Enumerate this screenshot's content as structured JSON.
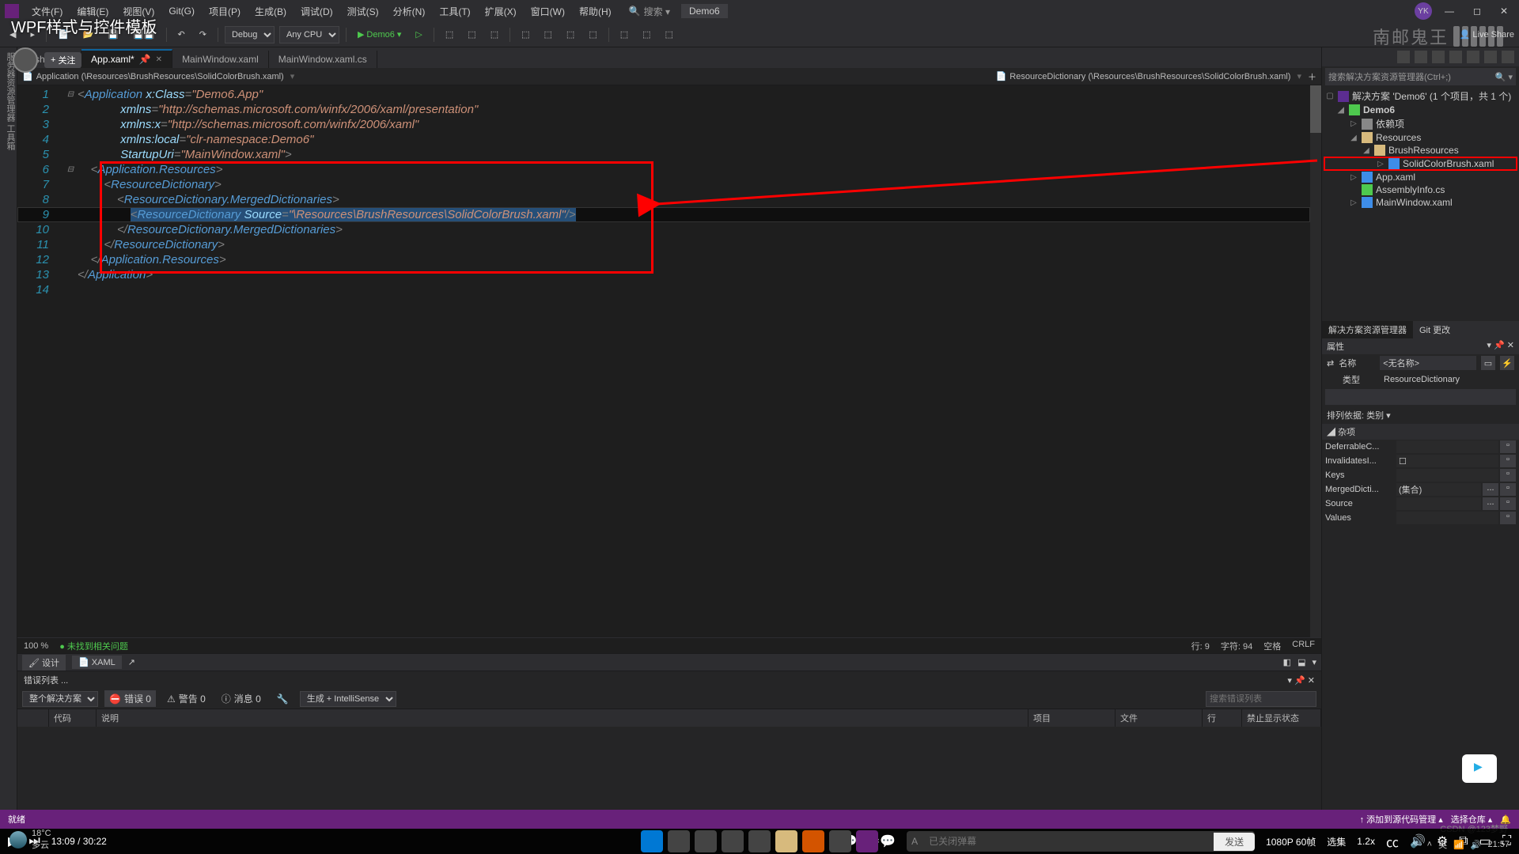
{
  "overlay_title": "WPF样式与控件模板",
  "menu": [
    "文件(F)",
    "编辑(E)",
    "视图(V)",
    "Git(G)",
    "项目(P)",
    "生成(B)",
    "调试(D)",
    "测试(S)",
    "分析(N)",
    "工具(T)",
    "扩展(X)",
    "窗口(W)",
    "帮助(H)"
  ],
  "top_search_placeholder": "搜索 ▾",
  "solution_name_top": "Demo6",
  "avatar_initials": "YK",
  "toolbar2": {
    "config": "Debug",
    "platform": "Any CPU",
    "start_label": "Demo6",
    "live_share": "Live Share"
  },
  "brand_cn": "南邮鬼王",
  "follow_label": "关注",
  "tabs": [
    {
      "label": "...sh.xaml*",
      "active": false
    },
    {
      "label": "App.xaml*",
      "active": true
    },
    {
      "label": "MainWindow.xaml",
      "active": false
    },
    {
      "label": "MainWindow.xaml.cs",
      "active": false
    }
  ],
  "breadcrumb": {
    "left": "Application (\\Resources\\BrushResources\\SolidColorBrush.xaml)",
    "right": "ResourceDictionary (\\Resources\\BrushResources\\SolidColorBrush.xaml)"
  },
  "code": {
    "l1": {
      "pre": "<",
      "tag": "Application",
      "sp": " ",
      "attr": "x:Class",
      "eq": "=",
      "val": "\"Demo6.App\""
    },
    "l2": {
      "attr": "xmlns",
      "eq": "=",
      "val": "\"http://schemas.microsoft.com/winfx/2006/xaml/presentation\""
    },
    "l3": {
      "attr": "xmlns:x",
      "eq": "=",
      "val": "\"http://schemas.microsoft.com/winfx/2006/xaml\""
    },
    "l4": {
      "attr": "xmlns:local",
      "eq": "=",
      "val": "\"clr-namespace:Demo6\""
    },
    "l5": {
      "attr": "StartupUri",
      "eq": "=",
      "val": "\"MainWindow.xaml\"",
      "close": ">"
    },
    "l6": {
      "pre": "<",
      "tag": "Application.Resources",
      "close": ">"
    },
    "l7": {
      "pre": "<",
      "tag": "ResourceDictionary",
      "close": ">"
    },
    "l8": {
      "pre": "<",
      "tag": "ResourceDictionary.MergedDictionaries",
      "close": ">"
    },
    "l9": {
      "pre": "<",
      "tag": "ResourceDictionary",
      "sp": " ",
      "attr": "Source",
      "eq": "=",
      "val": "\"\\Resources\\BrushResources\\SolidColorBrush.xaml\"",
      "close": "/>"
    },
    "l10": {
      "pre": "</",
      "tag": "ResourceDictionary.MergedDictionaries",
      "close": ">"
    },
    "l11": {
      "pre": "</",
      "tag": "ResourceDictionary",
      "close": ">"
    },
    "l12": {
      "pre": "</",
      "tag": "Application.Resources",
      "close": ">"
    },
    "l13": {
      "pre": "</",
      "tag": "Application",
      "close": ">"
    }
  },
  "status_strip": {
    "zoom": "100 %",
    "issues": "未找到相关问题",
    "line": "行: 9",
    "col": "字符: 94",
    "spaces": "空格",
    "crlf": "CRLF"
  },
  "design_xaml": {
    "design": "设计",
    "xaml": "XAML"
  },
  "error_panel": {
    "title": "错误列表 ...",
    "scope": "整个解决方案",
    "err": "错误 0",
    "warn": "警告 0",
    "info": "消息 0",
    "build": "生成 + IntelliSense",
    "search_placeholder": "搜索错误列表",
    "cols": [
      "",
      "代码",
      "说明",
      "项目",
      "文件",
      "行",
      "禁止显示状态"
    ]
  },
  "solution_explorer": {
    "search_placeholder": "搜索解决方案资源管理器(Ctrl+;)",
    "root": "解决方案 'Demo6' (1 个项目，共 1 个)",
    "project": "Demo6",
    "deps": "依赖项",
    "resources": "Resources",
    "brush": "BrushResources",
    "solidcolor": "SolidColorBrush.xaml",
    "appxaml": "App.xaml",
    "assemblyinfo": "AssemblyInfo.cs",
    "mainwindow": "MainWindow.xaml",
    "tab_se": "解决方案资源管理器",
    "tab_git": "Git 更改"
  },
  "properties": {
    "title": "属性",
    "name_lbl": "名称",
    "name_val": "<无名称>",
    "type_lbl": "类型",
    "type_val": "ResourceDictionary",
    "sort": "排列依据: 类别 ▾",
    "cat": "杂项",
    "rows": [
      {
        "n": "DeferrableC...",
        "v": ""
      },
      {
        "n": "InvalidatesI...",
        "v": "☐"
      },
      {
        "n": "Keys",
        "v": ""
      },
      {
        "n": "MergedDicti...",
        "v": "(集合)",
        "btn": "..."
      },
      {
        "n": "Source",
        "v": "",
        "btn": "..."
      },
      {
        "n": "Values",
        "v": ""
      }
    ]
  },
  "vs_status": {
    "ready": "就绪",
    "add_source": "↑ 添加到源代码管理 ▴",
    "select_repo": "选择仓库 ▴"
  },
  "video": {
    "time_cur": "13:09",
    "time_sep": " / ",
    "time_tot": "30:22",
    "danmu_placeholder": "已关闭弹幕",
    "send": "发送",
    "quality": "1080P 60帧",
    "episodes": "选集",
    "speed": "1.2x"
  },
  "weather": {
    "temp": "18°C",
    "desc": "多云"
  },
  "sys_time": "21:57",
  "csdn": "CSDN @123梦野"
}
